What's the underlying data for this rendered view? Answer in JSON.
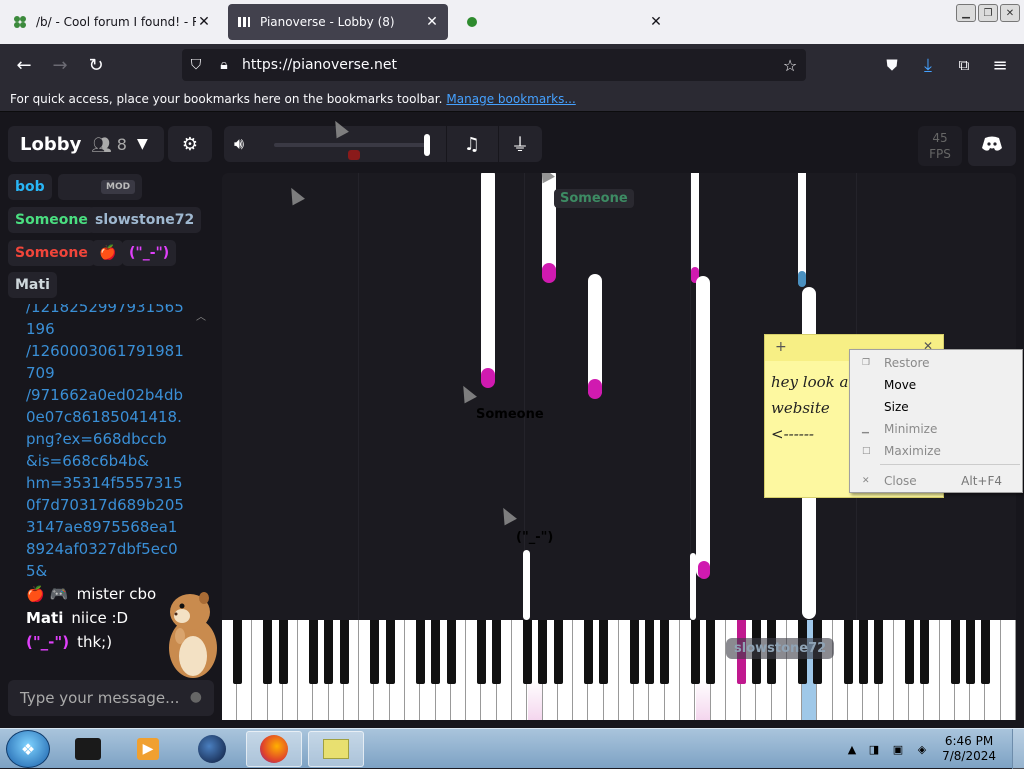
{
  "browser": {
    "tabs": [
      {
        "label": "/b/ - Cool forum I found! - Ran",
        "active": false
      },
      {
        "label": "Pianoverse - Lobby (8)",
        "active": true
      },
      {
        "label": "",
        "active": false
      }
    ],
    "url": "https://pianoverse.net",
    "bookmarks_text": "For quick access, place your bookmarks here on the bookmarks toolbar.",
    "bookmarks_link": "Manage bookmarks..."
  },
  "room": {
    "name": "Lobby",
    "user_count": "8",
    "fps_value": "45",
    "fps_label": "FPS"
  },
  "users": [
    {
      "name": "bob",
      "color": "#29b6f6"
    },
    {
      "name": "",
      "color": "#e53935",
      "tag": "MOD"
    },
    {
      "name": "Someone",
      "color": "#4ade80"
    },
    {
      "name": "slowstone72",
      "color": "#9fb8d0"
    },
    {
      "name": "Someone",
      "color": "#f0453a"
    },
    {
      "name": "🍎",
      "color": "#ff4444"
    },
    {
      "name": "(\"_-\")",
      "color": "#e040fb"
    },
    {
      "name": "Mati",
      "color": "#cfd8dc"
    }
  ],
  "chat": {
    "link_lines": [
      "/1218252997931565196",
      "/1260003061791981709",
      "/971662a0ed02b4db0e07c86185041418.png?ex=668dbccb",
      "&is=668c6b4b&",
      "hm=35314f55573150f7d70317d689b2053147ae8975568ea18924af0327dbf5ec05&"
    ],
    "messages": [
      {
        "name": "🍎 🎮",
        "text": "mister cbo",
        "color": "#ffffff"
      },
      {
        "name": "Mati",
        "text": "niice :D",
        "color": "#ffffff"
      },
      {
        "name": "(\"_-\")",
        "text": "thk;)",
        "color": "#e040fb"
      }
    ],
    "input_placeholder": "Type your message..."
  },
  "visualizer_labels": [
    {
      "text": "Someone",
      "color": "#3d8b63"
    },
    {
      "text": "Someone",
      "color": "#7a2a28"
    },
    {
      "text": "(\"_-\")",
      "color": "#6b2a7a"
    },
    {
      "text": "slowstone72",
      "color": "#5a6b7a"
    }
  ],
  "sticky_note": {
    "lines": [
      "hey look at",
      "website",
      "<------"
    ]
  },
  "context_menu": {
    "items": [
      {
        "label": "Restore",
        "disabled": true
      },
      {
        "label": "Move",
        "disabled": false
      },
      {
        "label": "Size",
        "disabled": false
      },
      {
        "label": "Minimize",
        "disabled": true
      },
      {
        "label": "Maximize",
        "disabled": true
      },
      {
        "label": "Close",
        "disabled": true,
        "shortcut": "Alt+F4"
      }
    ]
  },
  "taskbar": {
    "time": "6:46 PM",
    "date": "7/8/2024"
  }
}
